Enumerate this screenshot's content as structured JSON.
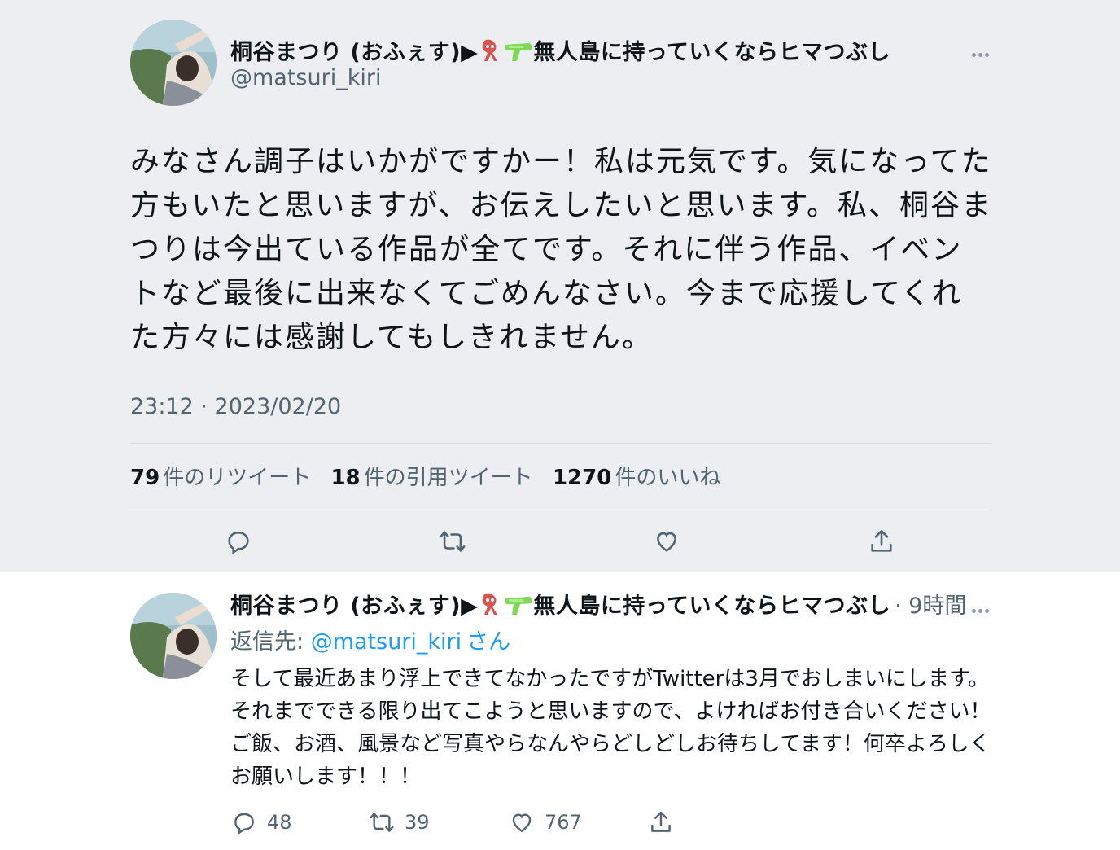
{
  "main_tweet": {
    "author_name": "桐谷まつり (おふぇす)▶",
    "author_name_suffix": "無人島に持っていくならヒマつぶし",
    "author_handle": "@matsuri_kiri",
    "text": "みなさん調子はいかがですかー！私は元気です。気になってた方もいたと思いますが、お伝えしたいと思います。私、桐谷まつりは今出ている作品が全てです。それに伴う作品、イベントなど最後に出来なくてごめんなさい。今まで応援してくれた方々には感謝してもしきれません。",
    "timestamp": "23:12 · 2023/02/20",
    "stats": [
      {
        "count": "79",
        "label": "件のリツイート"
      },
      {
        "count": "18",
        "label": "件の引用ツイート"
      },
      {
        "count": "1270",
        "label": "件のいいね"
      }
    ],
    "icons": [
      "reply-icon",
      "retweet-icon",
      "like-icon",
      "share-icon"
    ]
  },
  "reply_tweet": {
    "author_name": "桐谷まつり (おふぇす)▶",
    "author_name_suffix": "無人島に持っていくならヒマつぶし",
    "time": "· 9時間",
    "reply_to_prefix": "返信先: ",
    "reply_to_handle": "@matsuri_kiri",
    "reply_to_suffix": "さん",
    "text": "そして最近あまり浮上できてなかったですがTwitterは3月でおしまいにします。それまでできる限り出てこようと思いますので、よければお付き合いください！ご飯、お酒、風景など写真やらなんやらどしどしお待ちしてます！何卒よろしくお願いします！！！",
    "reply_count": "48",
    "retweet_count": "39",
    "like_count": "767"
  },
  "colors": {
    "accent": "#1d9bf0",
    "muted": "#536471",
    "highlight_bg": "#eceef1"
  }
}
